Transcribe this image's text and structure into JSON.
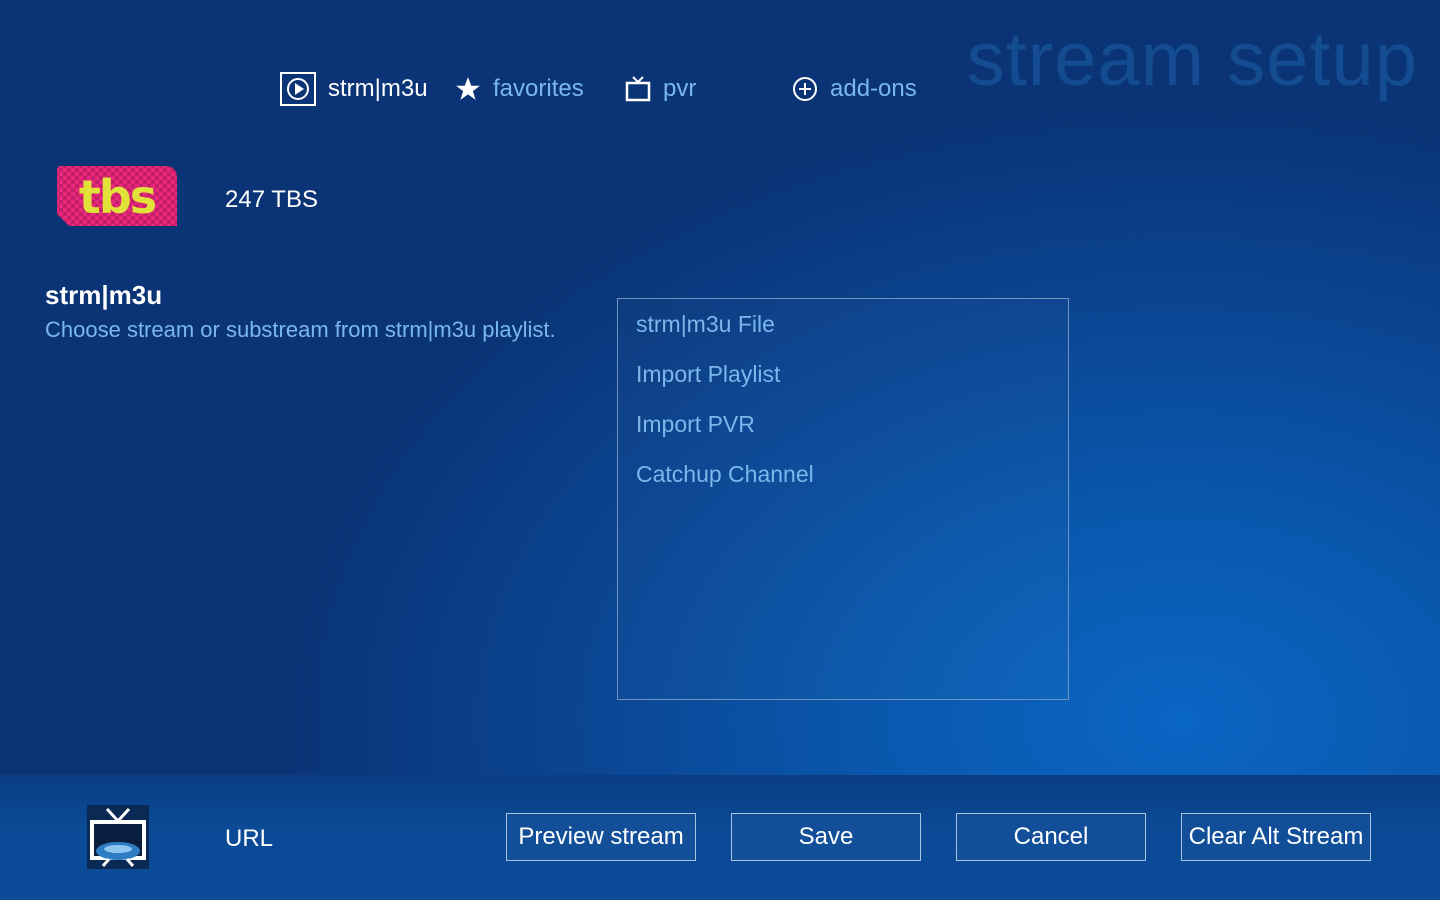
{
  "header": {
    "title": "stream setup"
  },
  "nav": [
    {
      "label": "strm|m3u",
      "icon": "play-circle-icon",
      "active": true
    },
    {
      "label": "favorites",
      "icon": "star-icon",
      "active": false
    },
    {
      "label": "pvr",
      "icon": "tv-icon",
      "active": false
    },
    {
      "label": "add-ons",
      "icon": "plus-circle-icon",
      "active": false
    }
  ],
  "channel": {
    "logo_text": "tbs",
    "name": "247 TBS"
  },
  "section": {
    "title": "strm|m3u",
    "description": "Choose stream or substream from strm|m3u playlist."
  },
  "list": {
    "items": [
      {
        "label": "strm|m3u File"
      },
      {
        "label": "Import Playlist"
      },
      {
        "label": "Import PVR"
      },
      {
        "label": "Catchup Channel"
      }
    ]
  },
  "footer": {
    "icon": "tv-globe-icon",
    "url_label": "URL",
    "buttons": {
      "preview": "Preview stream",
      "save": "Save",
      "cancel": "Cancel",
      "clear": "Clear Alt Stream"
    }
  },
  "colors": {
    "background": "#0b4694",
    "accent_text": "#7ab8ec",
    "header_title": "#154e94",
    "logo_pink": "#e8287a",
    "logo_yellow": "#e0e23a"
  }
}
